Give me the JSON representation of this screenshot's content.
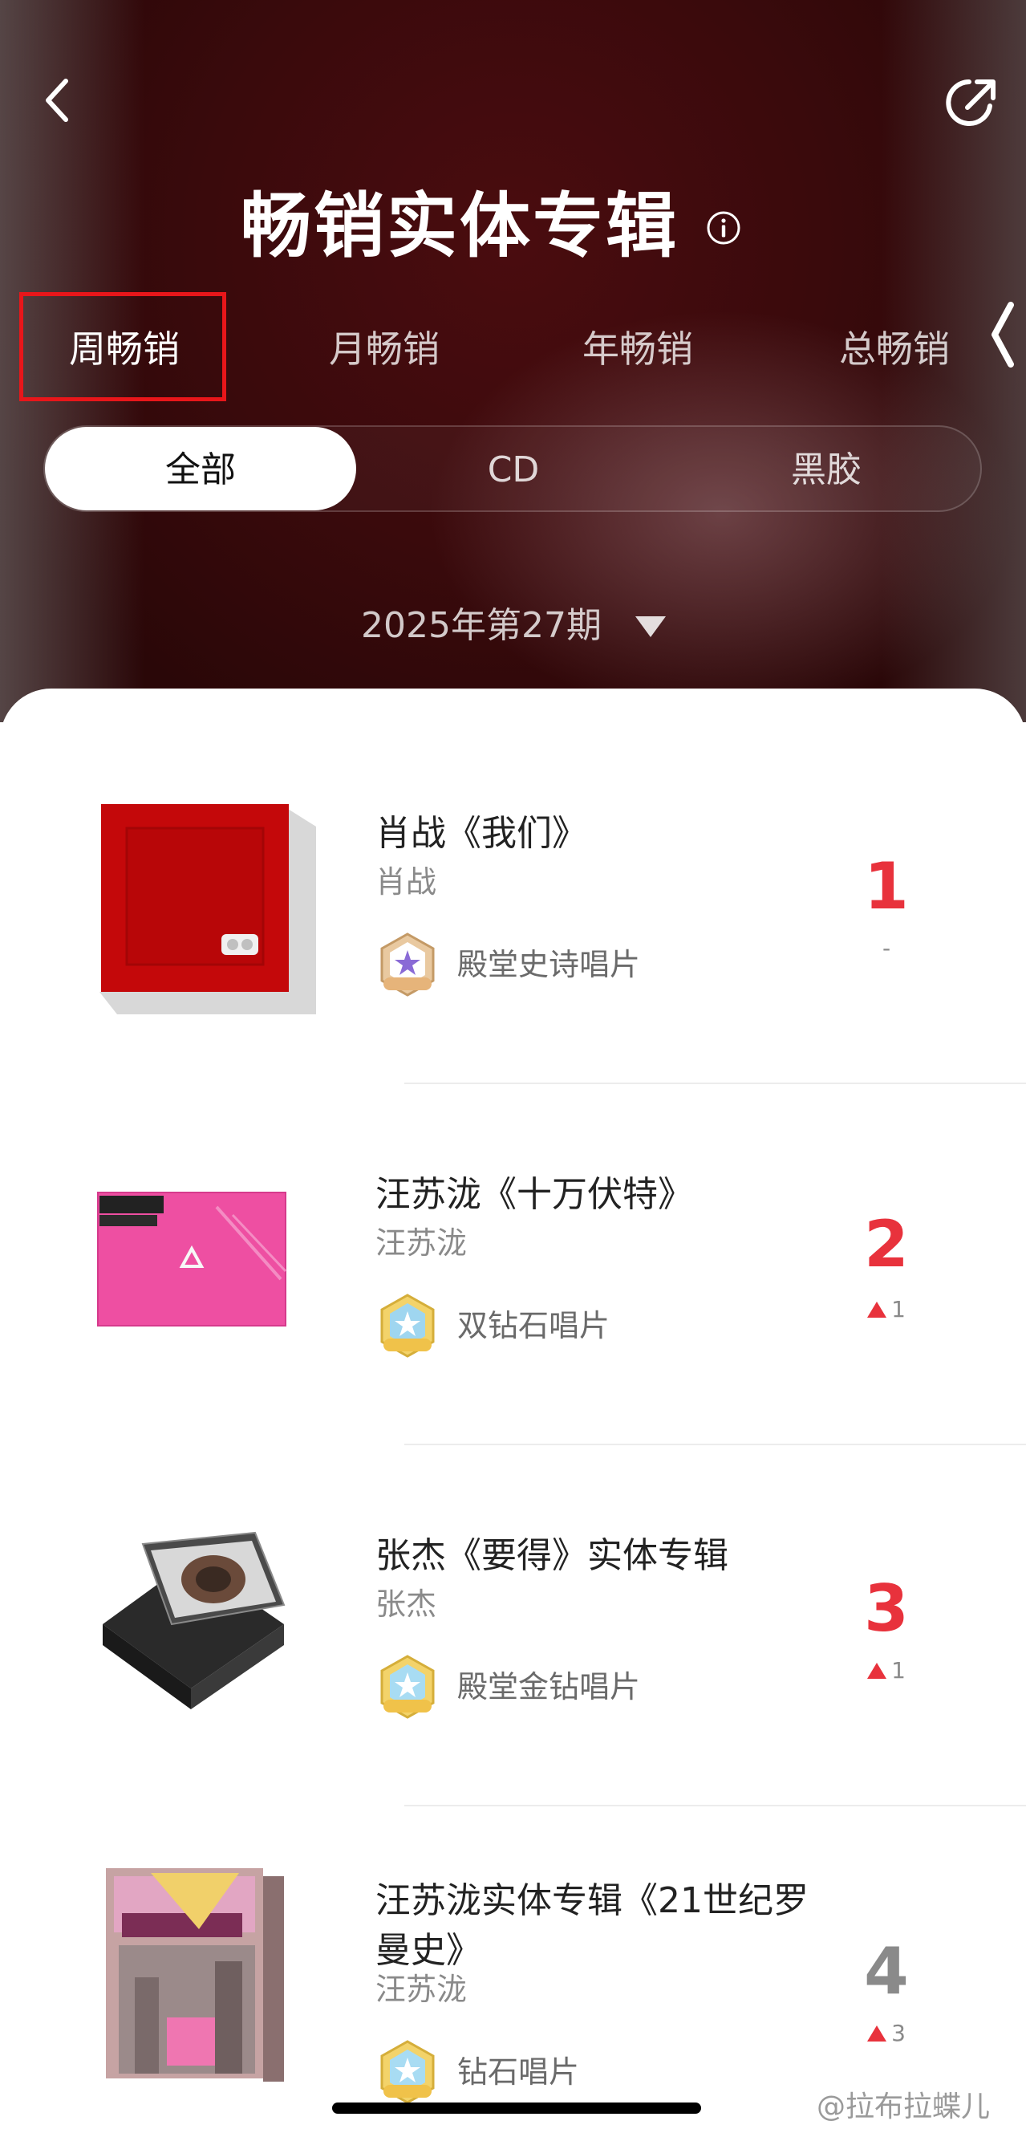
{
  "header": {
    "title": "畅销实体专辑",
    "back_icon": "chevron-left-icon",
    "share_icon": "share-icon",
    "info_icon": "info-icon"
  },
  "tabs": [
    {
      "label": "周畅销",
      "active": true
    },
    {
      "label": "月畅销",
      "active": false
    },
    {
      "label": "年畅销",
      "active": false
    },
    {
      "label": "总畅销",
      "active": false
    }
  ],
  "format_filter": [
    {
      "label": "全部",
      "active": true
    },
    {
      "label": "CD",
      "active": false
    },
    {
      "label": "黑胶",
      "active": false
    }
  ],
  "period": {
    "label": "2025年第27期"
  },
  "colors": {
    "accent": "#e8323c",
    "rank_other": "#8a8a8a",
    "highlight_box": "#e8161a",
    "hero_bg": "#3a0a0c"
  },
  "albums": [
    {
      "title": "肖战《我们》",
      "artist": "肖战",
      "certification": "殿堂史诗唱片",
      "rank": "1",
      "change": "-",
      "change_dir": "none"
    },
    {
      "title": "汪苏泷《十万伏特》",
      "artist": "汪苏泷",
      "certification": "双钻石唱片",
      "rank": "2",
      "change": "1",
      "change_dir": "up"
    },
    {
      "title": "张杰《要得》实体专辑",
      "artist": "张杰",
      "certification": "殿堂金钻唱片",
      "rank": "3",
      "change": "1",
      "change_dir": "up"
    },
    {
      "title": "汪苏泷实体专辑《21世纪罗曼史》",
      "artist": "汪苏泷",
      "certification": "钻石唱片",
      "rank": "4",
      "change": "3",
      "change_dir": "up"
    }
  ],
  "watermark": "@拉布拉蝶儿"
}
